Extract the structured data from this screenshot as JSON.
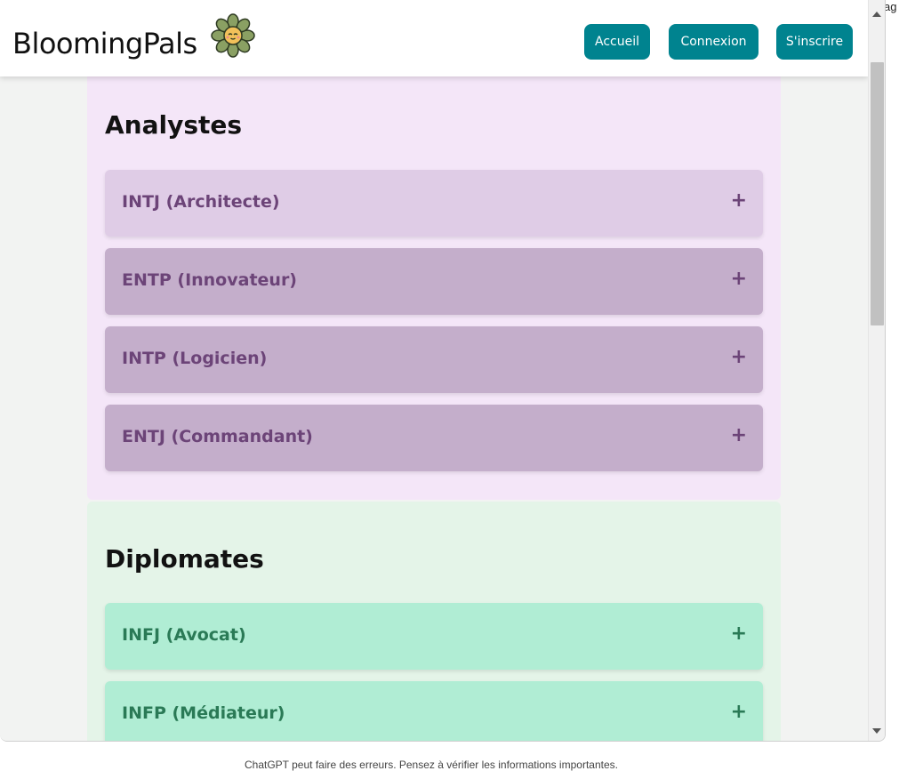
{
  "app": {
    "brand": "BloomingPals",
    "nav": {
      "home": "Accueil",
      "login": "Connexion",
      "signup": "S'inscrire"
    },
    "accent_color": "#00838f"
  },
  "sections": [
    {
      "title": "Analystes",
      "color": "#f4e6f8",
      "items": [
        {
          "label": "INTJ (Architecte)",
          "toggle": "+"
        },
        {
          "label": "ENTP (Innovateur)",
          "toggle": "+"
        },
        {
          "label": "INTP (Logicien)",
          "toggle": "+"
        },
        {
          "label": "ENTJ (Commandant)",
          "toggle": "+"
        }
      ]
    },
    {
      "title": "Diplomates",
      "color": "#e4f4e8",
      "items": [
        {
          "label": "INFJ (Avocat)",
          "toggle": "+"
        },
        {
          "label": "INFP (Médiateur)",
          "toggle": "+"
        }
      ]
    }
  ],
  "host": {
    "corner_text": "ag",
    "footer_text": "ChatGPT peut faire des erreurs. Pensez à vérifier les informations importantes."
  },
  "icons": {
    "logo": "flower-icon",
    "scroll_up": "scroll-up-arrow-icon",
    "scroll_down": "scroll-down-arrow-icon"
  }
}
